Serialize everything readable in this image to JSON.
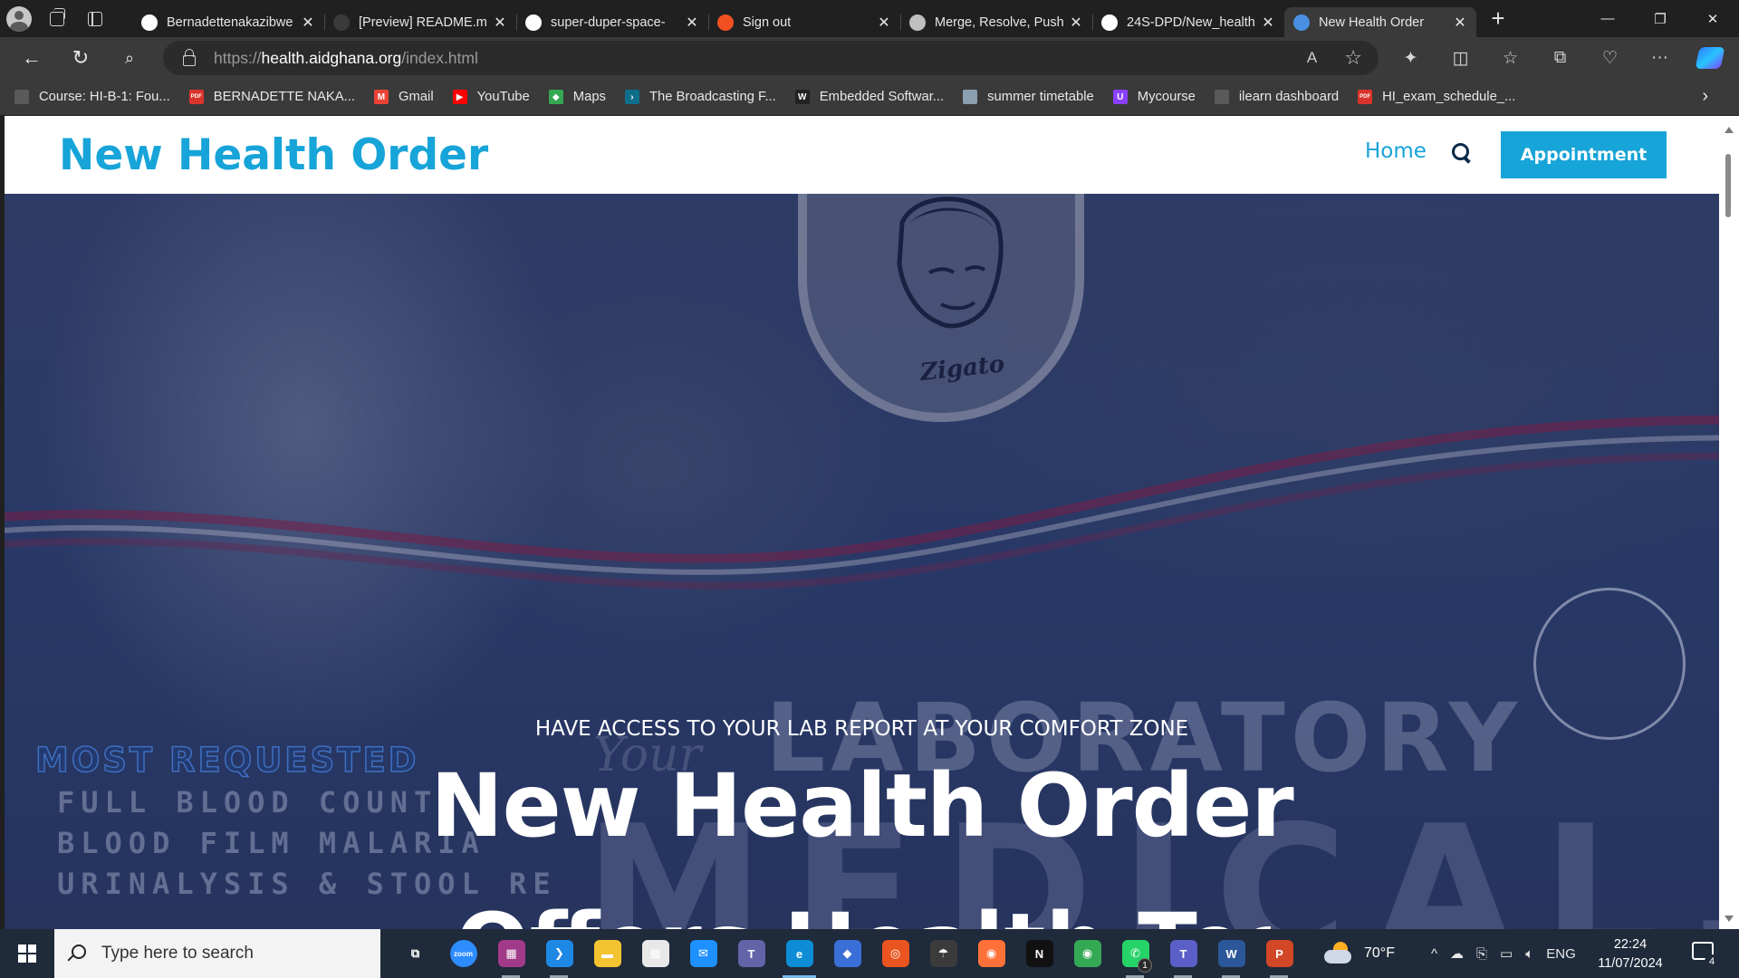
{
  "browser": {
    "tabs": [
      {
        "title": "Bernadettenakazibwe",
        "icon": "github-icon",
        "color": "#ffffff",
        "active": false
      },
      {
        "title": "[Preview] README.md",
        "icon": "github-icon",
        "color": "#3a3a3a",
        "active": false
      },
      {
        "title": "super-duper-space-",
        "icon": "codespaces-icon",
        "color": "#ffffff",
        "active": false
      },
      {
        "title": "Sign out",
        "icon": "microsoft-icon",
        "color": "#f25022",
        "active": false
      },
      {
        "title": "Merge, Resolve, Push",
        "icon": "openai-icon",
        "color": "#bfbfbf",
        "active": false
      },
      {
        "title": "24S-DPD/New_health",
        "icon": "github-icon",
        "color": "#ffffff",
        "active": false
      },
      {
        "title": "New Health Order",
        "icon": "site-icon",
        "color": "#4a90e2",
        "active": true
      }
    ],
    "tab_close_glyph": "✕",
    "new_tab_glyph": "+",
    "url_prefix": "https://",
    "url_host": "health.aidghana.org",
    "url_path": "/index.html",
    "read_aloud_glyph": "A",
    "favorite_glyph": "☆"
  },
  "bookmarks": [
    {
      "label": "Course: HI-B-1: Fou...",
      "icon": "page-icon",
      "color": "#5a5a5a",
      "glyph": ""
    },
    {
      "label": "BERNADETTE NAKA...",
      "icon": "pdf-icon",
      "color": "#d9342b",
      "glyph": "PDF"
    },
    {
      "label": "Gmail",
      "icon": "gmail-icon",
      "color": "#ea4335",
      "glyph": "M"
    },
    {
      "label": "YouTube",
      "icon": "youtube-icon",
      "color": "#ff0000",
      "glyph": "▶"
    },
    {
      "label": "Maps",
      "icon": "maps-icon",
      "color": "#34a853",
      "glyph": "◆"
    },
    {
      "label": "The Broadcasting F...",
      "icon": "broadcast-icon",
      "color": "#0e6e8c",
      "glyph": "›"
    },
    {
      "label": "Embedded Softwar...",
      "icon": "embedded-icon",
      "color": "#222222",
      "glyph": "W"
    },
    {
      "label": "summer timetable",
      "icon": "image-icon",
      "color": "#8aa0b0",
      "glyph": ""
    },
    {
      "label": "Mycourse",
      "icon": "mycourse-icon",
      "color": "#8a3ffc",
      "glyph": "U"
    },
    {
      "label": "ilearn dashboard",
      "icon": "page-icon",
      "color": "#5a5a5a",
      "glyph": ""
    },
    {
      "label": "HI_exam_schedule_...",
      "icon": "pdf-icon",
      "color": "#d9342b",
      "glyph": "PDF"
    }
  ],
  "site": {
    "brand": "New Health Order",
    "nav_home": "Home",
    "appointment_label": "Appointment",
    "hero_subtitle": "HAVE ACCESS TO YOUR LAB REPORT AT YOUR COMFORT ZONE",
    "hero_title": "New Health Order",
    "hero_title_line2": "Offers Health Tests",
    "bg_laboratory": "LABORATORY",
    "bg_medical": "MEDICAL.",
    "bg_your": "Your",
    "bg_most_requested": "MOST REQUESTED",
    "bg_tests": [
      "FULL BLOOD COUNT",
      "BLOOD FILM MALARIA",
      "URINALYSIS & STOOL RE"
    ],
    "seal_signature": "Zigato",
    "accent_color": "#17a4d8",
    "hero_color": "#2c3a64"
  },
  "taskbar": {
    "search_placeholder": "Type here to search",
    "apps": [
      {
        "name": "task-view-icon",
        "glyph": "⧉",
        "color": "transparent",
        "state": ""
      },
      {
        "name": "zoom-icon",
        "glyph": "zoom",
        "color": "#2d8cff",
        "state": ""
      },
      {
        "name": "winrar-icon",
        "glyph": "▦",
        "color": "#a23a8a",
        "state": "running"
      },
      {
        "name": "vscode-icon",
        "glyph": "❯",
        "color": "#1e88e5",
        "state": "running"
      },
      {
        "name": "file-explorer-icon",
        "glyph": "▬",
        "color": "#f4c430",
        "state": ""
      },
      {
        "name": "microsoft-store-icon",
        "glyph": "▦",
        "color": "#e8e8e8",
        "state": ""
      },
      {
        "name": "mail-icon",
        "glyph": "✉",
        "color": "#1e90ff",
        "state": ""
      },
      {
        "name": "teams-icon",
        "glyph": "T",
        "color": "#6264a7",
        "state": ""
      },
      {
        "name": "edge-icon",
        "glyph": "e",
        "color": "#0c8dd6",
        "state": "active"
      },
      {
        "name": "copilot-app-icon",
        "glyph": "◆",
        "color": "#3a6fd8",
        "state": ""
      },
      {
        "name": "ubuntu-icon",
        "glyph": "◎",
        "color": "#e95420",
        "state": ""
      },
      {
        "name": "parachute-icon",
        "glyph": "☂",
        "color": "#3b3b3b",
        "state": ""
      },
      {
        "name": "firefox-icon",
        "glyph": "◉",
        "color": "#ff7139",
        "state": ""
      },
      {
        "name": "netflix-icon",
        "glyph": "N",
        "color": "#111111",
        "state": ""
      },
      {
        "name": "chrome-icon",
        "glyph": "◉",
        "color": "#34a853",
        "state": ""
      },
      {
        "name": "whatsapp-icon",
        "glyph": "✆",
        "color": "#25d366",
        "state": "running",
        "badge": "1"
      },
      {
        "name": "teams-classic-icon",
        "glyph": "T",
        "color": "#5b5fc7",
        "state": "running"
      },
      {
        "name": "word-icon",
        "glyph": "W",
        "color": "#2b579a",
        "state": "running"
      },
      {
        "name": "powerpoint-icon",
        "glyph": "P",
        "color": "#d24726",
        "state": "running"
      }
    ],
    "temperature": "70°F",
    "language": "ENG",
    "time": "22:24",
    "date": "11/07/2024",
    "notifications": "4"
  }
}
